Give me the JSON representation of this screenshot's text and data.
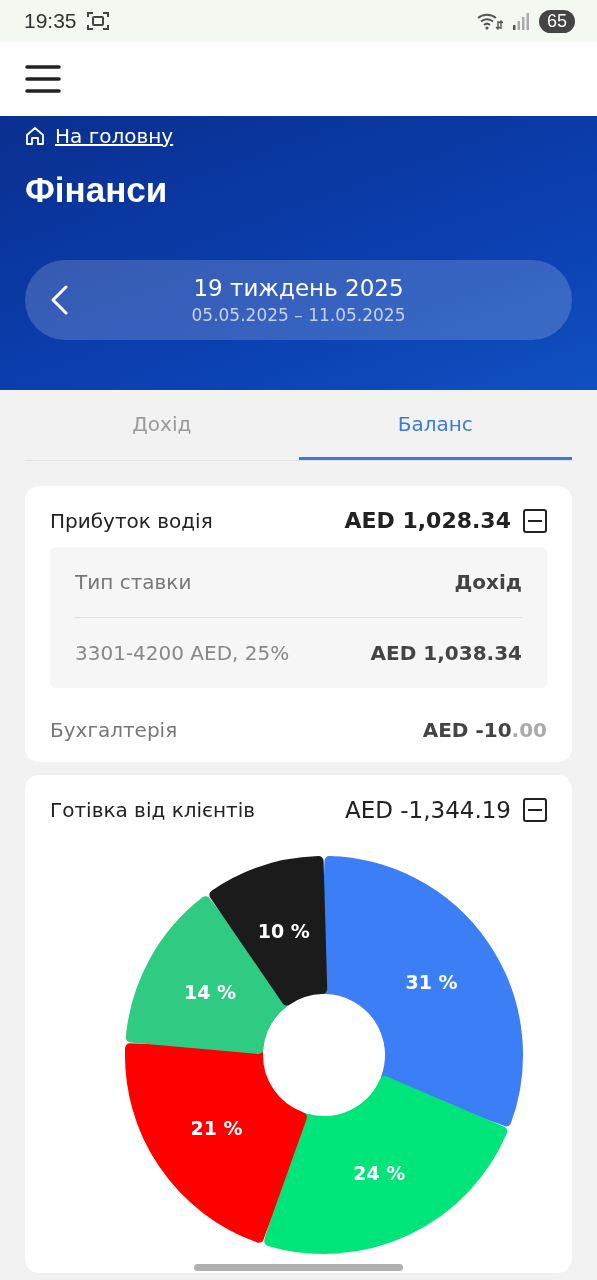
{
  "status_bar": {
    "time": "19:35",
    "battery": "65"
  },
  "breadcrumb": {
    "label": "На головну"
  },
  "title": "Фінанси",
  "week": {
    "title": "19 тиждень 2025",
    "range": "05.05.2025 – 11.05.2025"
  },
  "tabs": [
    {
      "label": "Дохід",
      "selected": false
    },
    {
      "label": "Баланс",
      "selected": true
    }
  ],
  "profit_card": {
    "title": "Прибуток водія",
    "amount": "AED 1,028.34",
    "expanded": true,
    "table": {
      "columns": [
        "Тип ставки",
        "Дохід"
      ],
      "rows": [
        [
          "3301-4200 AED, 25%",
          "AED 1,038.34"
        ]
      ]
    },
    "accounting": {
      "label": "Бухгалтерія",
      "amount": "AED -10",
      "fraction": ".00"
    }
  },
  "cash_card": {
    "title": "Готівка від клієнтів",
    "amount": "AED -1,344.19",
    "expanded": true,
    "chart_data": {
      "type": "donut",
      "values": [
        31,
        24,
        21,
        14,
        10
      ],
      "data_labels": true,
      "colors": [
        "#3b7ef6",
        "#00e57a",
        "#fe0000",
        "#2fcb83",
        "#1b1b1b"
      ],
      "value_labels": [
        "31 %",
        "24 %",
        "21 %",
        "14 %",
        "10 %"
      ]
    }
  }
}
